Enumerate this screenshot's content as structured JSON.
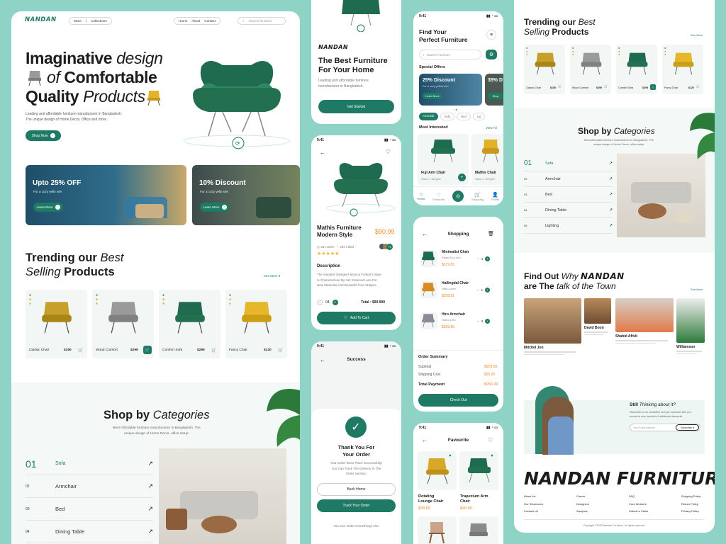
{
  "colors": {
    "brand": "#1e7a64",
    "accent": "#f08a24",
    "bg": "#8fd3c7",
    "card": "#f2f7f6"
  },
  "desktop": {
    "logo": "NANDAN",
    "nav": {
      "store": "Store",
      "collections": "Collections",
      "home": "Home",
      "about": "About",
      "contact": "Contact",
      "search_placeholder": "Search furniture"
    },
    "hero": {
      "w1": "Imaginative",
      "w2": "design",
      "w3": "of",
      "w4": "Comfortable",
      "w5": "Quality",
      "w6": "Products",
      "desc1": "Leading and affordable furniture manufacturer in Bangladesh.",
      "desc2": "The unique design of Home Decor, Office and more.",
      "cta": "Shop Now"
    },
    "banners": [
      {
        "title": "Upto 25% OFF",
        "sub": "For a cozy yello set!",
        "cta": "Learn More"
      },
      {
        "title": "10% Discount",
        "sub": "For a cozy yello set!",
        "cta": "Learn More"
      }
    ],
    "trending": {
      "t1": "Trending our",
      "t2": "Best",
      "t3": "Selling",
      "t4": "Products",
      "see_more": "See More",
      "products": [
        {
          "name": "Classic Chair",
          "price": "$150"
        },
        {
          "name": "Wood Comfort",
          "price": "$299"
        },
        {
          "name": "Comfort Sofa",
          "price": "$299"
        },
        {
          "name": "Fancy Chair",
          "price": "$120"
        }
      ]
    },
    "categories": {
      "t1": "Shop by",
      "t2": "Categories",
      "desc1": "Best Affordable furniture manufacturer in Bangladesh. The",
      "desc2": "unique design of Home Decor, office setup.",
      "items": [
        {
          "num": "01",
          "name": "Sofa"
        },
        {
          "num": "02",
          "name": "Armchair"
        },
        {
          "num": "03",
          "name": "Bed"
        },
        {
          "num": "04",
          "name": "Dining Table"
        }
      ]
    }
  },
  "phone_onboard": {
    "logo": "NANDAN",
    "title1": "The Best Furniture",
    "title2": "For Your Home",
    "desc1": "Leading and affordable furniture",
    "desc2": "manufacturer in Bangladesh.",
    "cta": "Get Started"
  },
  "phone_detail": {
    "time": "9:41",
    "name1": "Mathis Furniture",
    "name2": "Modern Style",
    "price": "$90.99",
    "seen": "341 Seen",
    "liked": "294 Liked",
    "more": "+5",
    "desc_title": "Description",
    "desc": [
      "The Swedish Designer Monica Forstar's Style",
      "Is Characterised By Her Enternal Love For",
      "New Materials And Beautiful Pure Shapes."
    ],
    "qty": "04",
    "total": "Total : $90.900",
    "cta": "Add To Cart"
  },
  "phone_success": {
    "time": "9:41",
    "title": "Success",
    "h1": "Thank You For",
    "h2": "Your Order",
    "msg": [
      "Your Order Been Place Successfully!",
      "You Can Track The Delivery In The",
      "Order Section."
    ],
    "back": "Back Home",
    "track": "Track Your Order",
    "foot": "You Can Order Somethings Also"
  },
  "phone_home": {
    "time": "9:41",
    "title1": "Find Your",
    "title2": "Perfect Furniture",
    "search": "Search Furniture",
    "offers": "Special Offers",
    "offer1": {
      "title": "25% Discount",
      "sub": "For a cozy yellow set!",
      "cta": "Learn More"
    },
    "offer2": {
      "title": "35% D",
      "cta": "Shop"
    },
    "chips": [
      "Armchair",
      "Sofa",
      "Bed",
      "Lig"
    ],
    "most": "Most Interested",
    "view_all": "View All",
    "items": [
      {
        "name": "Fuji Arm Chair",
        "sub": "Hans J. Wegner"
      },
      {
        "name": "Mathis Chair",
        "sub": "Hans J. Wegner"
      }
    ],
    "tabs": [
      "Home",
      "Favourite",
      "Shopping",
      "Profile"
    ]
  },
  "phone_cart": {
    "title": "Shopping",
    "items": [
      {
        "name": "Minimalist Chair",
        "sub": "Regal Do Lobo",
        "price": "$279.65",
        "qty": "4"
      },
      {
        "name": "Hallingdal Chair",
        "sub": "Hatit-Loren",
        "price": "$258.91",
        "qty": "1"
      },
      {
        "name": "Hiro Armchair",
        "sub": "Hatit-Loren",
        "price": "$369.86",
        "qty": "3"
      }
    ],
    "summary": "Order Summary",
    "subtotal_l": "Subtotal",
    "subtotal": "$929.09",
    "ship_l": "Shipping Cost",
    "ship": "$26.00",
    "total_l": "Total Payment",
    "total": "$956.90",
    "cta": "Check Out"
  },
  "phone_fav": {
    "time": "9:41",
    "title": "Favourite",
    "items": [
      {
        "name1": "Rotating",
        "name2": "Lounge Chair",
        "price": "$39.60"
      },
      {
        "name1": "Trapezium Arm",
        "name2": "Chair",
        "price": "$40.80"
      }
    ]
  },
  "right": {
    "trend": {
      "t1": "Trending our",
      "t2": "Best",
      "t3": "Selling",
      "t4": "Products",
      "see_more": "See More",
      "products": [
        {
          "name": "Classic Chair",
          "price": "$150"
        },
        {
          "name": "Wood Comfort",
          "price": "$299"
        },
        {
          "name": "Comfort Sofa",
          "price": "$299"
        },
        {
          "name": "Fancy Chair",
          "price": "$120"
        }
      ]
    },
    "cats": {
      "t1": "Shop by",
      "t2": "Categories",
      "desc1": "Best Affordable furniture manufacturer in Bangladesh. The",
      "desc2": "unique design of Home Decor, office setup.",
      "items": [
        {
          "num": "01",
          "name": "Sofa"
        },
        {
          "num": "02",
          "name": "Armchair"
        },
        {
          "num": "03",
          "name": "Bed"
        },
        {
          "num": "04",
          "name": "Dining Table"
        },
        {
          "num": "05",
          "name": "Lighting"
        }
      ]
    },
    "talk": {
      "t1": "Find Out",
      "t2": "Why",
      "t3": "NANDAN",
      "t4": "are The",
      "t5": "talk of the Town",
      "see_more": "See More",
      "people": [
        {
          "name": "Mitchel Jon"
        },
        {
          "name": "David Boon"
        },
        {
          "name": "Shahid Afridi"
        },
        {
          "name": "Williamson"
        }
      ]
    },
    "news": {
      "t1": "Still",
      "t2": "Thinking about it?",
      "desc1": "Subscribe to our newsletter and get exclusive offer pre-",
      "desc2": "access to new launches & additional discounts.",
      "placeholder": "Your Email address",
      "cta": "Subscribe"
    },
    "footer": {
      "brand": "NANDAN FURNITURE",
      "cols": [
        [
          "About Us",
          "Our Showroom",
          "Contact Us"
        ],
        [
          "Career",
          "Designers",
          "Samples"
        ],
        [
          "FAQ",
          "Core Workers",
          "Submit a Claim"
        ],
        [
          "Shipping Policy",
          "Return Policy",
          "Privacy Policy"
        ]
      ],
      "copy": "Copyright ©2023 Nandan Furniture. All rights reserved."
    }
  }
}
